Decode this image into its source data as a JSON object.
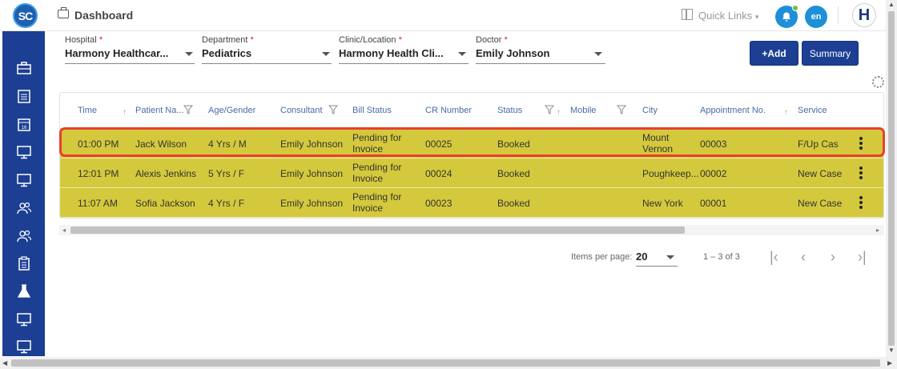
{
  "app": {
    "logo": "SC",
    "title": "Dashboard"
  },
  "topbar": {
    "quick_links": "Quick Links",
    "quick_links_caret": "▾",
    "lang": "en",
    "user_initial": "H",
    "bell_icon": "bell-icon",
    "colors": {
      "accent": "#1e8fd8",
      "brand": "#1c3f94"
    }
  },
  "filters": {
    "hospital": {
      "label": "Hospital",
      "required": "*",
      "value": "Harmony Healthcar..."
    },
    "department": {
      "label": "Department",
      "required": "*",
      "value": "Pediatrics"
    },
    "clinic": {
      "label": "Clinic/Location",
      "required": "*",
      "value": "Harmony Health Cli..."
    },
    "doctor": {
      "label": "Doctor",
      "required": "*",
      "value": "Emily Johnson"
    }
  },
  "actions": {
    "add": "+Add",
    "summary": "Summary"
  },
  "table": {
    "columns": {
      "time": "Time",
      "patient": "Patient Na...",
      "age": "Age/Gender",
      "consultant": "Consultant",
      "bill": "Bill Status",
      "cr": "CR Number",
      "status": "Status",
      "mobile": "Mobile",
      "city": "City",
      "appt": "Appointment No.",
      "service": "Service"
    },
    "rows": [
      {
        "time": "01:00 PM",
        "patient": "Jack Wilson",
        "age": "4 Yrs / M",
        "consultant": "Emily Johnson",
        "bill": "Pending for Invoice",
        "cr": "00025",
        "status": "Booked",
        "mobile": "",
        "city": "Mount Vernon",
        "appt": "00003",
        "service": "F/Up Cas"
      },
      {
        "time": "12:01 PM",
        "patient": "Alexis Jenkins",
        "age": "5 Yrs / F",
        "consultant": "Emily Johnson",
        "bill": "Pending for Invoice",
        "cr": "00024",
        "status": "Booked",
        "mobile": "",
        "city": "Poughkeep...",
        "appt": "00002",
        "service": "New Case"
      },
      {
        "time": "11:07 AM",
        "patient": "Sofia Jackson",
        "age": "4 Yrs / F",
        "consultant": "Emily Johnson",
        "bill": "Pending for Invoice",
        "cr": "00023",
        "status": "Booked",
        "mobile": "",
        "city": "New York",
        "appt": "00001",
        "service": "New Case"
      }
    ],
    "row_color": "#d4c93c",
    "highlight_color": "#e8402a"
  },
  "paginator": {
    "items_label": "Items per page:",
    "page_size": "20",
    "range": "1 – 3 of 3"
  },
  "sidebar_icons": [
    "briefcase-icon",
    "report-icon",
    "calendar-icon",
    "monitor-icon",
    "monitor-icon",
    "users-icon",
    "users-icon",
    "clipboard-icon",
    "flask-icon",
    "monitor-icon",
    "monitor-icon"
  ]
}
